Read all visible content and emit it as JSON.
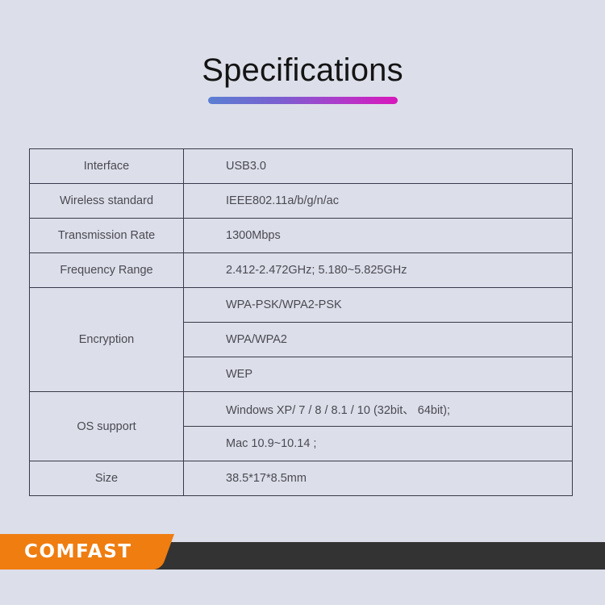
{
  "page": {
    "background_color": "#dcdee9"
  },
  "header": {
    "title": "Specifications",
    "underline_gradient_from": "#5a7fd2",
    "underline_gradient_to": "#d817bb"
  },
  "spec_table": {
    "rows": [
      {
        "label": "Interface",
        "values": [
          "USB3.0"
        ]
      },
      {
        "label": "Wireless standard",
        "values": [
          "IEEE802.11a/b/g/n/ac"
        ]
      },
      {
        "label": "Transmission Rate",
        "values": [
          "1300Mbps"
        ]
      },
      {
        "label": "Frequency Range",
        "values": [
          "2.412-2.472GHz;  5.180~5.825GHz"
        ]
      },
      {
        "label": "Encryption",
        "values": [
          "WPA-PSK/WPA2-PSK",
          "WPA/WPA2",
          "WEP"
        ]
      },
      {
        "label": "OS support",
        "values": [
          "Windows XP/ 7 / 8 / 8.1 / 10 (32bit、 64bit);",
          "Mac 10.9~10.14 ;"
        ]
      },
      {
        "label": "Size",
        "values": [
          "38.5*17*8.5mm"
        ]
      }
    ]
  },
  "footer": {
    "brand": "COMFAST",
    "brand_banner_color": "#ef7d10",
    "bar_color": "#333333"
  }
}
